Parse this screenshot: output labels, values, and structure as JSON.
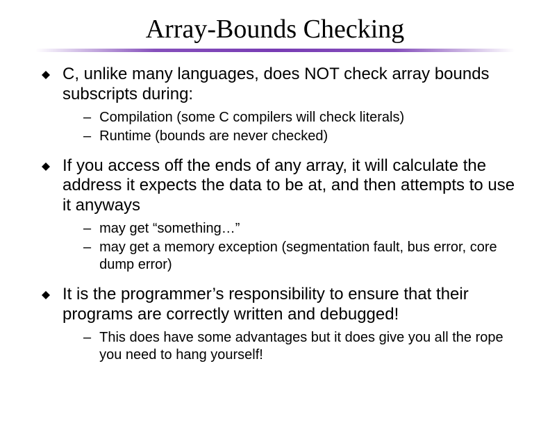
{
  "title": "Array-Bounds Checking",
  "bullets": [
    {
      "text": "C, unlike many languages, does NOT check array bounds subscripts during:",
      "subs": [
        "Compilation  (some C compilers will check literals)",
        "Runtime  (bounds are never checked)"
      ]
    },
    {
      "text": "If you access off the ends of any array, it will calculate the address it expects the data to be at, and then attempts to use it anyways",
      "subs": [
        "may get “something…”",
        "may get a memory exception (segmentation fault, bus error, core dump error)"
      ]
    },
    {
      "text": "It is the programmer’s responsibility to ensure that their programs are correctly written and debugged!",
      "subs": [
        "This does have some advantages but it does give you all the rope you need to hang yourself!"
      ]
    }
  ]
}
